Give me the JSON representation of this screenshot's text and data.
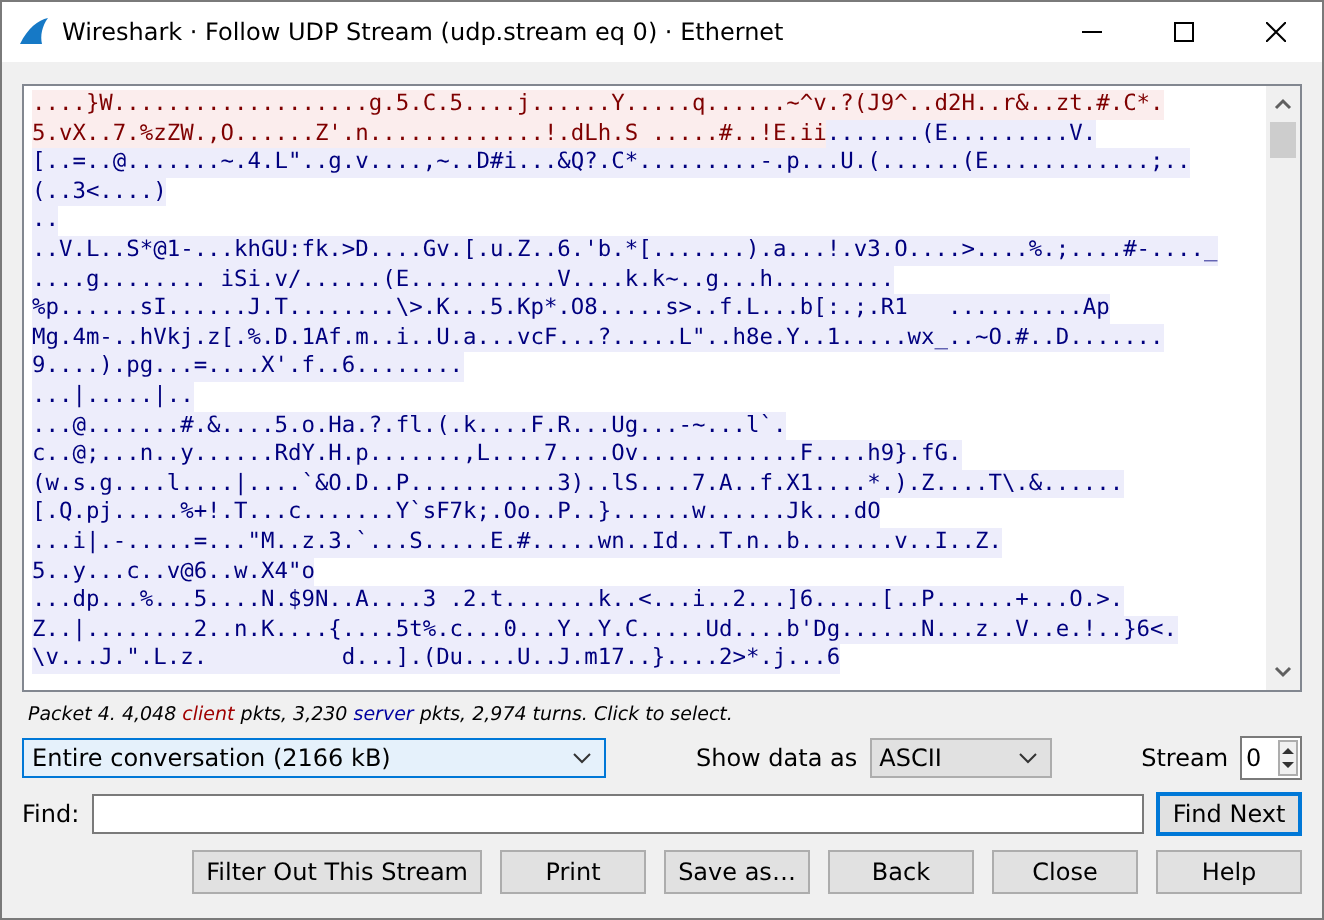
{
  "window": {
    "title": "Wireshark · Follow UDP Stream (udp.stream eq 0) · Ethernet"
  },
  "stream_lines": [
    {
      "segments": [
        {
          "kind": "client",
          "text": "....}W...................g.5.C.5....j......Y.....q......~^v.?(J9^..d2H..r&..zt.#.C*."
        }
      ]
    },
    {
      "segments": [
        {
          "kind": "client",
          "text": "5.vX..7.%zZW.,O......Z'.n.............!.dLh.S .....#..!E.ii"
        },
        {
          "kind": "server",
          "text": ".......(E.........V."
        }
      ]
    },
    {
      "segments": [
        {
          "kind": "server",
          "text": "[..=..@.......~.4.L\"..g.v....,~..D#i...&Q?.C*.........-.p...U.(......(E............;.."
        }
      ]
    },
    {
      "segments": [
        {
          "kind": "server",
          "text": "(..3<....)"
        }
      ]
    },
    {
      "segments": [
        {
          "kind": "server",
          "text": ".."
        }
      ]
    },
    {
      "segments": [
        {
          "kind": "server",
          "text": "..V.L..S*@1-...khGU:fk.>D....Gv.[.u.Z..6.'b.*[.......).a...!.v3.O....>....%.;....#-...._"
        }
      ]
    },
    {
      "segments": [
        {
          "kind": "server",
          "text": "....g........ iSi.v/......(E...........V....k.k~..g...h........."
        }
      ]
    },
    {
      "segments": [
        {
          "kind": "server",
          "text": "%p......sI......J.T........\\>.K...5.Kp*.O8.....s>..f.L...b[:.;.R1   ..........Ap"
        }
      ]
    },
    {
      "segments": [
        {
          "kind": "server",
          "text": "Mg.4m-..hVkj.z[.%.D.1Af.m..i..U.a...vcF...?.....L\"..h8e.Y..1.....wx_..~O.#..D......."
        }
      ]
    },
    {
      "segments": [
        {
          "kind": "server",
          "text": "9....).pg...=....X'.f..6........"
        }
      ]
    },
    {
      "segments": [
        {
          "kind": "server",
          "text": "...|.....|.."
        }
      ]
    },
    {
      "segments": [
        {
          "kind": "server",
          "text": "...@.......#.&....5.o.Ha.?.fl.(.k....F.R...Ug...-~...l`."
        }
      ]
    },
    {
      "segments": [
        {
          "kind": "server",
          "text": "c..@;...n..y......RdY.H.p.......,L....7....Ov............F....h9}.fG."
        }
      ]
    },
    {
      "segments": [
        {
          "kind": "server",
          "text": "(w.s.g....l....|....`&O.D..P...........3)..lS....7.A..f.X1....*.).Z....T\\.&......"
        }
      ]
    },
    {
      "segments": [
        {
          "kind": "server",
          "text": "[.Q.pj.....%+!.T...c.......Y`sF7k;.Oo..P..}......w......Jk...dO"
        }
      ]
    },
    {
      "segments": [
        {
          "kind": "server",
          "text": "...i|.-.....=...\"M..z.3.`...S.....E.#.....wn..Id...T.n..b.......v..I..Z."
        }
      ]
    },
    {
      "segments": [
        {
          "kind": "server",
          "text": "5..y...c..v@6..w.X4\"o"
        }
      ]
    },
    {
      "segments": [
        {
          "kind": "server",
          "text": "...dp...%...5....N.$9N..A....3 .2.t.......k..<...i..2...]6.....[..P......+...O.>."
        }
      ]
    },
    {
      "segments": [
        {
          "kind": "server",
          "text": "Z..|........2..n.K....{....5t%.c...0...Y..Y.C.....Ud....b'Dg......N...z..V..e.!..}6<."
        }
      ]
    },
    {
      "segments": [
        {
          "kind": "server",
          "text": "\\v...J.\".L.z.          d...].(Du....U..J.m17..}....2>*.j...6"
        }
      ]
    }
  ],
  "status": [
    {
      "kind": "plain",
      "text": "Packet 4. 4,048 "
    },
    {
      "kind": "client",
      "text": "client"
    },
    {
      "kind": "plain",
      "text": " pkts, 3,230 "
    },
    {
      "kind": "server",
      "text": "server"
    },
    {
      "kind": "plain",
      "text": " pkts, 2,974 turns. Click to select."
    }
  ],
  "conversation_select": {
    "value": "Entire conversation (2166 kB)"
  },
  "show_data_as": {
    "label": "Show data as",
    "value": "ASCII"
  },
  "stream": {
    "label": "Stream",
    "value": "0"
  },
  "find": {
    "label": "Find:",
    "button": "Find Next"
  },
  "buttons": [
    "Filter Out This Stream",
    "Print",
    "Save as…",
    "Back",
    "Close",
    "Help"
  ]
}
